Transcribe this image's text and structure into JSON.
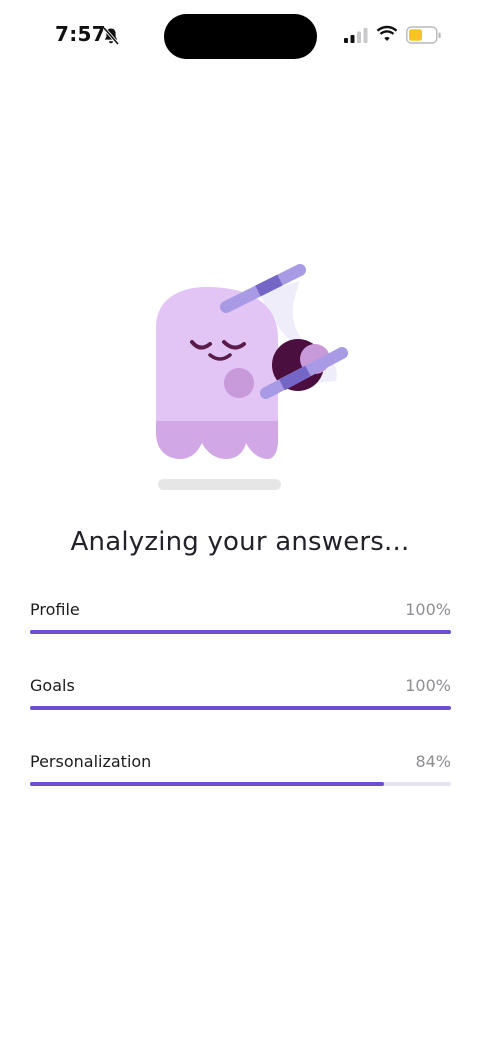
{
  "status_bar": {
    "time": "7:57",
    "signal_icon": "cellular-signal-icon",
    "wifi_icon": "wifi-icon",
    "battery_icon": "battery-icon",
    "silent_icon": "bell-slash-icon",
    "battery_color": "#f7c325"
  },
  "illustration": {
    "icon": "ghost-hourglass-illustration"
  },
  "title": "Analyzing your answers...",
  "progress": [
    {
      "label": "Profile",
      "value_text": "100%",
      "value": 1.0
    },
    {
      "label": "Goals",
      "value_text": "100%",
      "value": 1.0
    },
    {
      "label": "Personalization",
      "value_text": "84%",
      "value": 0.84
    }
  ],
  "colors": {
    "accent": "#6c4fd1",
    "ghost": "#e2c4f5",
    "ghost_shadow": "#d2a7e6"
  }
}
